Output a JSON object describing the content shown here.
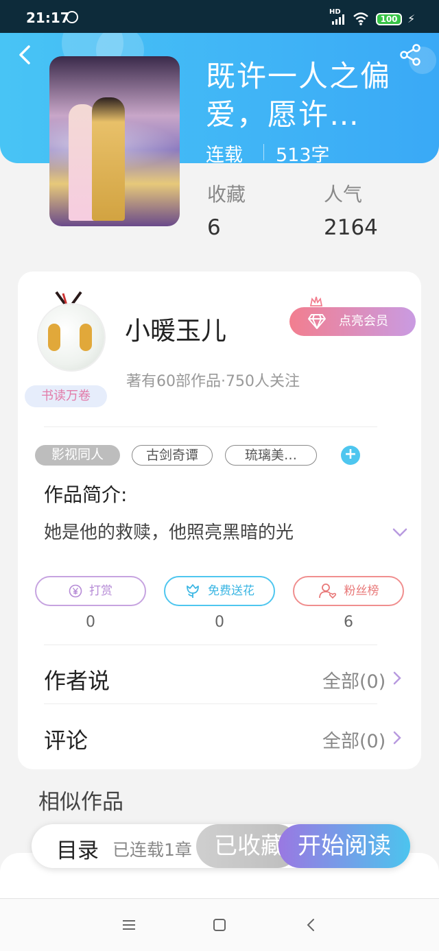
{
  "status_bar": {
    "time": "21:17",
    "hd_label": "HD",
    "battery": "100"
  },
  "book": {
    "title": "既许一人之偏爱，愿许…",
    "status": "连载",
    "word_count": "513字",
    "stats": [
      {
        "label": "收藏",
        "value": "6"
      },
      {
        "label": "人气",
        "value": "2164"
      }
    ]
  },
  "author": {
    "name": "小暖玉儿",
    "meta": "著有60部作品·750人关注",
    "badge": "书读万卷",
    "vip_button": "点亮会员"
  },
  "tags": [
    "影视同人",
    "古剑奇谭",
    "琉璃美…"
  ],
  "intro": {
    "title": "作品简介:",
    "text": "她是他的救赎，他照亮黑暗的光"
  },
  "actions": [
    {
      "label": "打赏",
      "count": "0",
      "icon": "yen-icon",
      "color": "#c6a3e0"
    },
    {
      "label": "免费送花",
      "count": "0",
      "icon": "flower-icon",
      "color": "#4ec6ef"
    },
    {
      "label": "粉丝榜",
      "count": "6",
      "icon": "fan-user-icon",
      "color": "#f08e8e"
    }
  ],
  "rows": [
    {
      "label": "作者说",
      "all": "全部(0)"
    },
    {
      "label": "评论",
      "all": "全部(0)"
    }
  ],
  "similar_title": "相似作品",
  "bottom_bar": {
    "toc": "目录",
    "toc_sub": "已连载1章",
    "collected": "已收藏",
    "read": "开始阅读"
  },
  "colors": {
    "header_blue": "#3aa9f6",
    "accent_purple": "#9a78e2",
    "accent_cyan": "#4cc4ee"
  }
}
